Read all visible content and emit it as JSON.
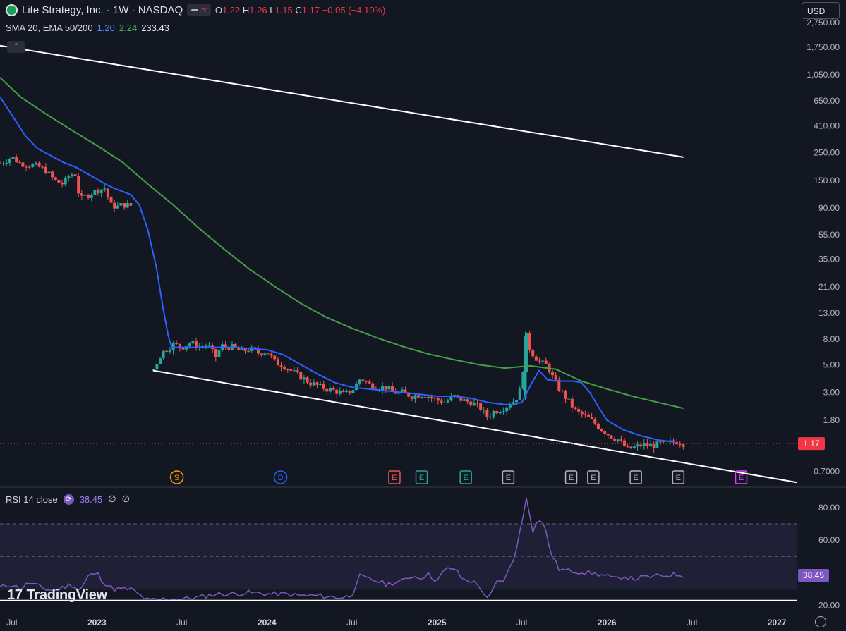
{
  "header": {
    "symbol_title": "Lite Strategy, Inc. · 1W · NASDAQ",
    "ohlc": [
      {
        "k": "O",
        "v": "1.22"
      },
      {
        "k": "H",
        "v": "1.26"
      },
      {
        "k": "L",
        "v": "1.15"
      },
      {
        "k": "C",
        "v": "1.17"
      }
    ],
    "change": "−0.05 (−4.10%)",
    "icons": {
      "logo": "company-logo-icon",
      "pill_left": "dash-icon",
      "pill_right": "wave-icon"
    }
  },
  "indicators": {
    "label": "SMA 20, EMA 50/200",
    "v1": "1.20",
    "v2": "2.24",
    "v3": "233.43"
  },
  "currency": "USD",
  "colors": {
    "background": "#131722",
    "up": "#26a69a",
    "down": "#ef5350",
    "sma20": "#2962ff",
    "ema200": "#43a047",
    "rsi": "#7e57c2",
    "last_price": "#f23645"
  },
  "last_price_label": "1.17",
  "events": [
    {
      "date": "2023.47",
      "text": "S",
      "kind": "split",
      "color": "#ff9800"
    },
    {
      "date": "2024.08",
      "text": "D",
      "kind": "dividend",
      "color": "#2962ff"
    },
    {
      "date": "2024.75",
      "text": "E",
      "kind": "earnings",
      "color": "#ef5350"
    },
    {
      "date": "2024.91",
      "text": "E",
      "kind": "earnings",
      "color": "#26a69a"
    },
    {
      "date": "2025.17",
      "text": "E",
      "kind": "earnings",
      "color": "#26a69a"
    },
    {
      "date": "2025.42",
      "text": "E",
      "kind": "earnings",
      "color": "#b2b5be"
    },
    {
      "date": "2025.79",
      "text": "E",
      "kind": "earnings",
      "color": "#b2b5be"
    },
    {
      "date": "2025.92",
      "text": "E",
      "kind": "earnings",
      "color": "#b2b5be"
    },
    {
      "date": "2026.17",
      "text": "E",
      "kind": "earnings",
      "color": "#b2b5be"
    },
    {
      "date": "2026.42",
      "text": "E",
      "kind": "earnings",
      "color": "#b2b5be"
    },
    {
      "date": "2026.79",
      "text": "E",
      "kind": "earnings-upcoming",
      "color": "#e040fb"
    }
  ],
  "rsi": {
    "label": "RSI 14 close",
    "value": "38.45",
    "extra1": "∅",
    "extra2": "∅"
  },
  "branding": {
    "logo_text": "TradingView",
    "mark": "17"
  },
  "chart_data": [
    {
      "type": "candlestick",
      "title": "Lite Strategy, Inc. · 1W · NASDAQ",
      "y_scale": "log",
      "ylim": [
        0.53,
        2900
      ],
      "xlim": [
        2022.43,
        2027.12
      ],
      "x_ticks": [
        {
          "t": 2022.5,
          "label": "Jul"
        },
        {
          "t": 2023.0,
          "label": "2023"
        },
        {
          "t": 2023.5,
          "label": "Jul"
        },
        {
          "t": 2024.0,
          "label": "2024"
        },
        {
          "t": 2024.5,
          "label": "Jul"
        },
        {
          "t": 2025.0,
          "label": "2025"
        },
        {
          "t": 2025.5,
          "label": "Jul"
        },
        {
          "t": 2026.0,
          "label": "2026"
        },
        {
          "t": 2026.5,
          "label": "Jul"
        },
        {
          "t": 2027.0,
          "label": "2027"
        }
      ],
      "y_ticks": [
        "2,750.00",
        "1,750.00",
        "1,050.00",
        "650.00",
        "410.00",
        "250.00",
        "150.00",
        "90.00",
        "55.00",
        "35.00",
        "21.00",
        "13.00",
        "8.00",
        "5.00",
        "3.00",
        "1.80",
        "1.17",
        "0.7000"
      ],
      "price_path": [
        [
          2022.43,
          205
        ],
        [
          2022.5,
          230
        ],
        [
          2022.55,
          205
        ],
        [
          2022.6,
          200
        ],
        [
          2022.65,
          195
        ],
        [
          2022.7,
          180
        ],
        [
          2022.75,
          150
        ],
        [
          2022.8,
          140
        ],
        [
          2022.83,
          160
        ],
        [
          2022.87,
          175
        ],
        [
          2022.9,
          105
        ],
        [
          2022.95,
          115
        ],
        [
          2023.0,
          125
        ],
        [
          2023.05,
          130
        ],
        [
          2023.08,
          95
        ],
        [
          2023.12,
          92
        ],
        [
          2023.15,
          96
        ],
        [
          2023.2,
          94
        ],
        [
          2023.33,
          4.5
        ],
        [
          2023.38,
          6.2
        ],
        [
          2023.45,
          7.3
        ],
        [
          2023.5,
          6.9
        ],
        [
          2023.55,
          7.5
        ],
        [
          2023.6,
          7.0
        ],
        [
          2023.65,
          7.2
        ],
        [
          2023.7,
          5.8
        ],
        [
          2023.73,
          7.1
        ],
        [
          2023.8,
          6.9
        ],
        [
          2023.85,
          6.4
        ],
        [
          2023.9,
          6.7
        ],
        [
          2023.95,
          6.2
        ],
        [
          2024.0,
          6.4
        ],
        [
          2024.05,
          5.2
        ],
        [
          2024.1,
          4.9
        ],
        [
          2024.15,
          4.4
        ],
        [
          2024.2,
          4.0
        ],
        [
          2024.25,
          3.6
        ],
        [
          2024.3,
          3.4
        ],
        [
          2024.35,
          3.2
        ],
        [
          2024.4,
          3.1
        ],
        [
          2024.45,
          2.9
        ],
        [
          2024.5,
          3.1
        ],
        [
          2024.55,
          3.9
        ],
        [
          2024.6,
          3.5
        ],
        [
          2024.65,
          3.3
        ],
        [
          2024.7,
          3.3
        ],
        [
          2024.75,
          3.0
        ],
        [
          2024.8,
          3.0
        ],
        [
          2024.85,
          2.8
        ],
        [
          2024.9,
          2.9
        ],
        [
          2024.95,
          2.8
        ],
        [
          2025.0,
          2.6
        ],
        [
          2025.05,
          2.5
        ],
        [
          2025.1,
          2.8
        ],
        [
          2025.15,
          2.6
        ],
        [
          2025.2,
          2.5
        ],
        [
          2025.25,
          2.3
        ],
        [
          2025.3,
          1.9
        ],
        [
          2025.33,
          2.1
        ],
        [
          2025.38,
          2.2
        ],
        [
          2025.42,
          2.4
        ],
        [
          2025.46,
          2.6
        ],
        [
          2025.5,
          3.3
        ],
        [
          2025.52,
          9.0
        ],
        [
          2025.55,
          6.5
        ],
        [
          2025.6,
          5.3
        ],
        [
          2025.65,
          4.9
        ],
        [
          2025.68,
          4.0
        ],
        [
          2025.72,
          3.2
        ],
        [
          2025.77,
          2.6
        ],
        [
          2025.82,
          2.1
        ],
        [
          2025.87,
          1.95
        ],
        [
          2025.92,
          1.75
        ],
        [
          2025.97,
          1.5
        ],
        [
          2026.02,
          1.35
        ],
        [
          2026.07,
          1.25
        ],
        [
          2026.12,
          1.05
        ],
        [
          2026.17,
          1.1
        ],
        [
          2026.22,
          1.15
        ],
        [
          2026.27,
          1.12
        ],
        [
          2026.32,
          1.17
        ],
        [
          2026.37,
          1.19
        ],
        [
          2026.42,
          1.22
        ],
        [
          2026.45,
          1.17
        ]
      ],
      "series": [
        {
          "name": "SMA 20",
          "current": "1.20",
          "values": [
            [
              2022.43,
              700
            ],
            [
              2022.5,
              500
            ],
            [
              2022.58,
              340
            ],
            [
              2022.65,
              270
            ],
            [
              2022.72,
              240
            ],
            [
              2022.8,
              210
            ],
            [
              2022.88,
              190
            ],
            [
              2022.96,
              165
            ],
            [
              2023.05,
              140
            ],
            [
              2023.1,
              130
            ],
            [
              2023.2,
              115
            ],
            [
              2023.25,
              95
            ],
            [
              2023.3,
              60
            ],
            [
              2023.35,
              30
            ],
            [
              2023.39,
              14
            ],
            [
              2023.42,
              8.5
            ],
            [
              2023.44,
              6.9
            ],
            [
              2023.6,
              6.9
            ],
            [
              2023.8,
              6.9
            ],
            [
              2024.0,
              6.6
            ],
            [
              2024.1,
              6.0
            ],
            [
              2024.2,
              5.0
            ],
            [
              2024.3,
              4.2
            ],
            [
              2024.4,
              3.6
            ],
            [
              2024.5,
              3.3
            ],
            [
              2024.6,
              3.2
            ],
            [
              2024.7,
              3.1
            ],
            [
              2024.8,
              3.0
            ],
            [
              2024.9,
              2.9
            ],
            [
              2025.0,
              2.8
            ],
            [
              2025.1,
              2.8
            ],
            [
              2025.2,
              2.7
            ],
            [
              2025.3,
              2.5
            ],
            [
              2025.4,
              2.4
            ],
            [
              2025.45,
              2.4
            ],
            [
              2025.5,
              2.5
            ],
            [
              2025.55,
              3.4
            ],
            [
              2025.6,
              4.5
            ],
            [
              2025.65,
              3.8
            ],
            [
              2025.7,
              3.7
            ],
            [
              2025.8,
              3.7
            ],
            [
              2025.85,
              3.6
            ],
            [
              2025.9,
              3.0
            ],
            [
              2025.95,
              2.3
            ],
            [
              2026.0,
              1.8
            ],
            [
              2026.1,
              1.5
            ],
            [
              2026.2,
              1.35
            ],
            [
              2026.3,
              1.25
            ],
            [
              2026.4,
              1.2
            ]
          ]
        },
        {
          "name": "EMA 50/200",
          "current": "2.24",
          "values": [
            [
              2022.43,
              1000
            ],
            [
              2022.55,
              700
            ],
            [
              2022.7,
              510
            ],
            [
              2022.85,
              380
            ],
            [
              2023.0,
              285
            ],
            [
              2023.15,
              210
            ],
            [
              2023.3,
              140
            ],
            [
              2023.45,
              95
            ],
            [
              2023.6,
              62
            ],
            [
              2023.75,
              42
            ],
            [
              2023.9,
              29
            ],
            [
              2024.05,
              21
            ],
            [
              2024.2,
              15.5
            ],
            [
              2024.35,
              12
            ],
            [
              2024.5,
              9.8
            ],
            [
              2024.65,
              8.2
            ],
            [
              2024.8,
              7.0
            ],
            [
              2024.95,
              6.1
            ],
            [
              2025.1,
              5.5
            ],
            [
              2025.25,
              5.0
            ],
            [
              2025.4,
              4.7
            ],
            [
              2025.55,
              4.9
            ],
            [
              2025.7,
              4.6
            ],
            [
              2025.85,
              3.7
            ],
            [
              2026.0,
              3.2
            ],
            [
              2026.15,
              2.8
            ],
            [
              2026.3,
              2.5
            ],
            [
              2026.45,
              2.24
            ]
          ]
        },
        {
          "name": "EMA 50/200",
          "current": "233.43",
          "values": []
        }
      ],
      "trendlines": [
        {
          "name": "upper",
          "from": [
            2022.43,
            1800
          ],
          "to": [
            2026.45,
            230
          ]
        },
        {
          "name": "lower",
          "from": [
            2023.33,
            4.5
          ],
          "to": [
            2027.12,
            0.57
          ]
        }
      ],
      "last_price": 1.17
    },
    {
      "type": "line",
      "title": "RSI 14 close",
      "ylim": [
        16,
        92
      ],
      "y_ticks": [
        "80.00",
        "60.00",
        "38.45",
        "20.00"
      ],
      "levels": [
        70,
        50,
        30
      ],
      "values": [
        [
          2022.43,
          31
        ],
        [
          2022.5,
          33
        ],
        [
          2022.55,
          30
        ],
        [
          2022.6,
          34
        ],
        [
          2022.65,
          32
        ],
        [
          2022.7,
          30
        ],
        [
          2022.75,
          29
        ],
        [
          2022.8,
          31
        ],
        [
          2022.85,
          33
        ],
        [
          2022.9,
          29
        ],
        [
          2022.95,
          38
        ],
        [
          2023.0,
          40
        ],
        [
          2023.05,
          33
        ],
        [
          2023.1,
          30
        ],
        [
          2023.15,
          30
        ],
        [
          2023.2,
          30
        ],
        [
          2023.3,
          23
        ],
        [
          2023.4,
          24
        ],
        [
          2023.5,
          24
        ],
        [
          2023.6,
          25
        ],
        [
          2023.7,
          27
        ],
        [
          2023.8,
          27
        ],
        [
          2023.9,
          28
        ],
        [
          2024.0,
          27
        ],
        [
          2024.1,
          27
        ],
        [
          2024.2,
          26
        ],
        [
          2024.3,
          26
        ],
        [
          2024.4,
          25
        ],
        [
          2024.45,
          25
        ],
        [
          2024.5,
          26
        ],
        [
          2024.54,
          38
        ],
        [
          2024.6,
          36
        ],
        [
          2024.65,
          35
        ],
        [
          2024.7,
          33
        ],
        [
          2024.75,
          34
        ],
        [
          2024.8,
          35
        ],
        [
          2024.85,
          38
        ],
        [
          2024.9,
          37
        ],
        [
          2024.95,
          39
        ],
        [
          2025.0,
          35
        ],
        [
          2025.05,
          42
        ],
        [
          2025.1,
          43
        ],
        [
          2025.15,
          36
        ],
        [
          2025.2,
          35
        ],
        [
          2025.25,
          32
        ],
        [
          2025.3,
          23
        ],
        [
          2025.35,
          34
        ],
        [
          2025.4,
          36
        ],
        [
          2025.45,
          48
        ],
        [
          2025.5,
          70
        ],
        [
          2025.53,
          89
        ],
        [
          2025.56,
          65
        ],
        [
          2025.6,
          73
        ],
        [
          2025.63,
          70
        ],
        [
          2025.67,
          52
        ],
        [
          2025.72,
          42
        ],
        [
          2025.8,
          41
        ],
        [
          2025.9,
          40
        ],
        [
          2026.0,
          38
        ],
        [
          2026.05,
          36
        ],
        [
          2026.1,
          38
        ],
        [
          2026.15,
          36
        ],
        [
          2026.2,
          37
        ],
        [
          2026.3,
          38
        ],
        [
          2026.4,
          39
        ],
        [
          2026.45,
          38.45
        ]
      ],
      "trendline": {
        "from": [
          2022.43,
          23
        ],
        "to": [
          2027.12,
          23
        ]
      }
    }
  ]
}
